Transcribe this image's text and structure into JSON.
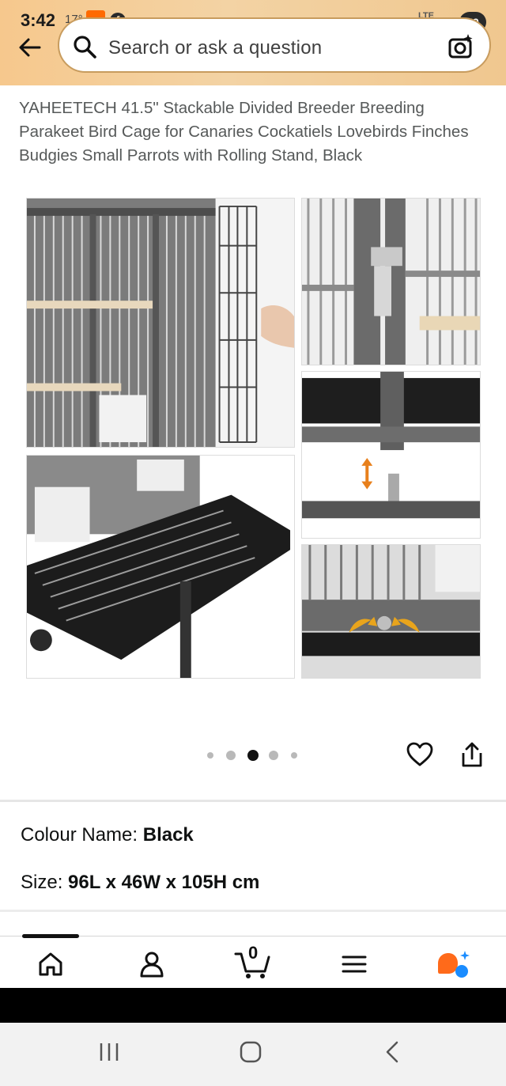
{
  "status_bar": {
    "time": "3:42",
    "temperature": "17°",
    "network": "LTE",
    "battery": "59"
  },
  "search": {
    "placeholder": "Search or ask a question"
  },
  "product": {
    "title": "YAHEETECH 41.5\" Stackable Divided Breeder Breeding Parakeet Bird Cage for Canaries Cockatiels Lovebirds Finches Budgies Small Parrots with Rolling Stand, Black",
    "image_count": 5,
    "active_image_index": 2,
    "colour_label": "Colour Name:",
    "colour_value": "Black",
    "size_label": "Size:",
    "size_value": "96L x 46W x 105H cm"
  },
  "bottom_nav": {
    "items": [
      "home-icon",
      "account-icon",
      "cart-icon",
      "menu-icon",
      "rufus-ai-icon"
    ],
    "cart_count": "0",
    "active_index": 0
  },
  "colors": {
    "header_bg": "#f3d3a4",
    "accent_arrow": "#e8801c",
    "ai_orange": "#ff6a1a",
    "ai_blue": "#1a8cff"
  }
}
